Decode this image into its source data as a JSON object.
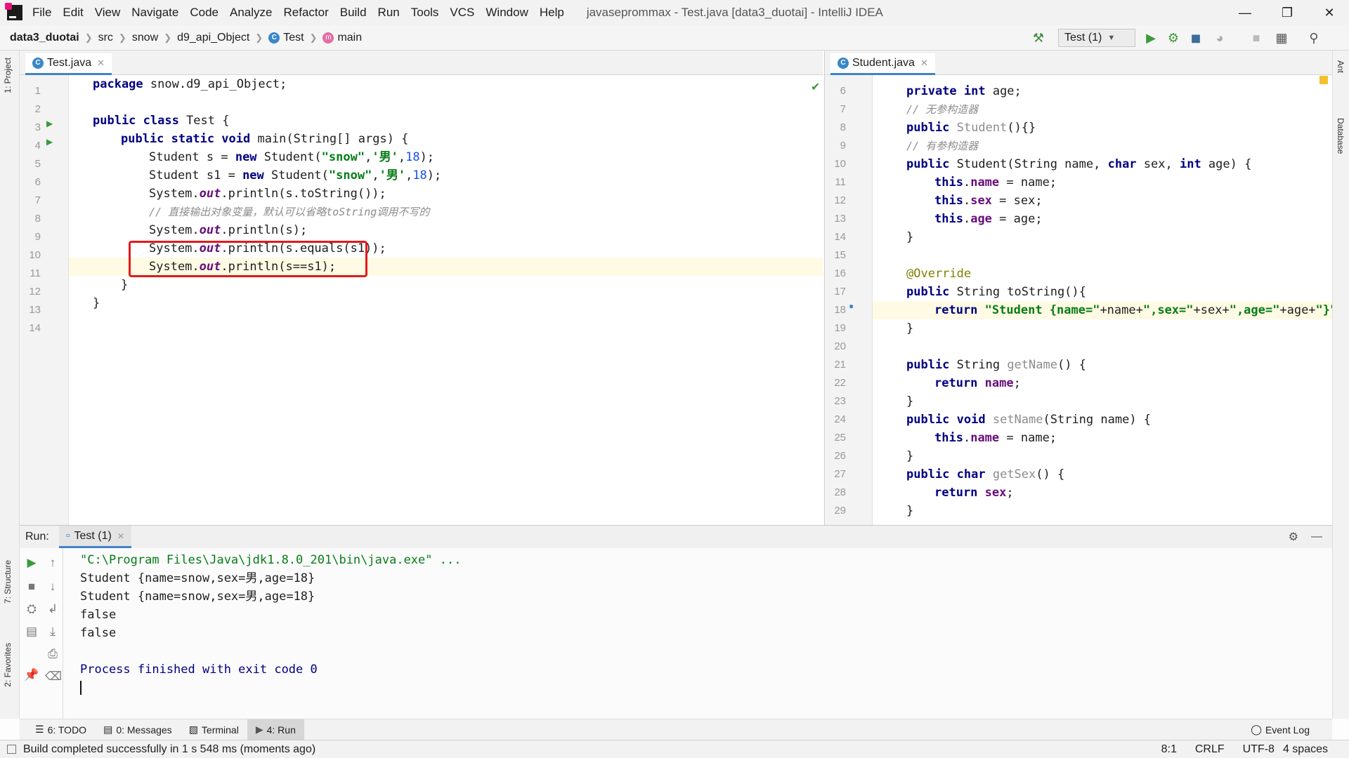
{
  "menubar": {
    "items": [
      "File",
      "Edit",
      "View",
      "Navigate",
      "Code",
      "Analyze",
      "Refactor",
      "Build",
      "Run",
      "Tools",
      "VCS",
      "Window",
      "Help"
    ],
    "window_title": "javaseprommax - Test.java [data3_duotai] - IntelliJ IDEA"
  },
  "breadcrumb": {
    "items": [
      "data3_duotai",
      "src",
      "snow",
      "d9_api_Object",
      "Test",
      "main"
    ]
  },
  "toolbar": {
    "run_config": "Test (1)"
  },
  "left_strip": {
    "project": "1: Project",
    "structure": "7: Structure",
    "favorites": "2: Favorites"
  },
  "right_strip": {
    "ant": "Ant",
    "database": "Database"
  },
  "left_editor": {
    "tab": "Test.java",
    "line_numbers": [
      "1",
      "2",
      "3",
      "4",
      "5",
      "6",
      "7",
      "8",
      "9",
      "10",
      "11",
      "12",
      "13",
      "14"
    ]
  },
  "right_editor": {
    "tab": "Student.java",
    "line_numbers": [
      "6",
      "7",
      "8",
      "9",
      "10",
      "11",
      "12",
      "13",
      "14",
      "15",
      "16",
      "17",
      "18",
      "19",
      "20",
      "21",
      "22",
      "23",
      "24",
      "25",
      "26",
      "27",
      "28",
      "29"
    ]
  },
  "run_panel": {
    "label": "Run:",
    "tab": "Test (1)",
    "console": [
      "\"C:\\Program Files\\Java\\jdk1.8.0_201\\bin\\java.exe\" ...",
      "Student {name=snow,sex=男,age=18}",
      "Student {name=snow,sex=男,age=18}",
      "false",
      "false",
      "",
      "Process finished with exit code 0"
    ]
  },
  "tool_buttons": {
    "todo": "6: TODO",
    "messages": "0: Messages",
    "terminal": "Terminal",
    "run": "4: Run",
    "event_log": "Event Log"
  },
  "statusbar": {
    "message": "Build completed successfully in 1 s 548 ms (moments ago)",
    "position": "8:1",
    "line_sep": "CRLF",
    "encoding": "UTF-8",
    "indent": "4 spaces"
  },
  "colors": {
    "accent": "#4083c9",
    "highlight_box": "#e01b1b",
    "keyword": "#000080",
    "string": "#067d17"
  }
}
